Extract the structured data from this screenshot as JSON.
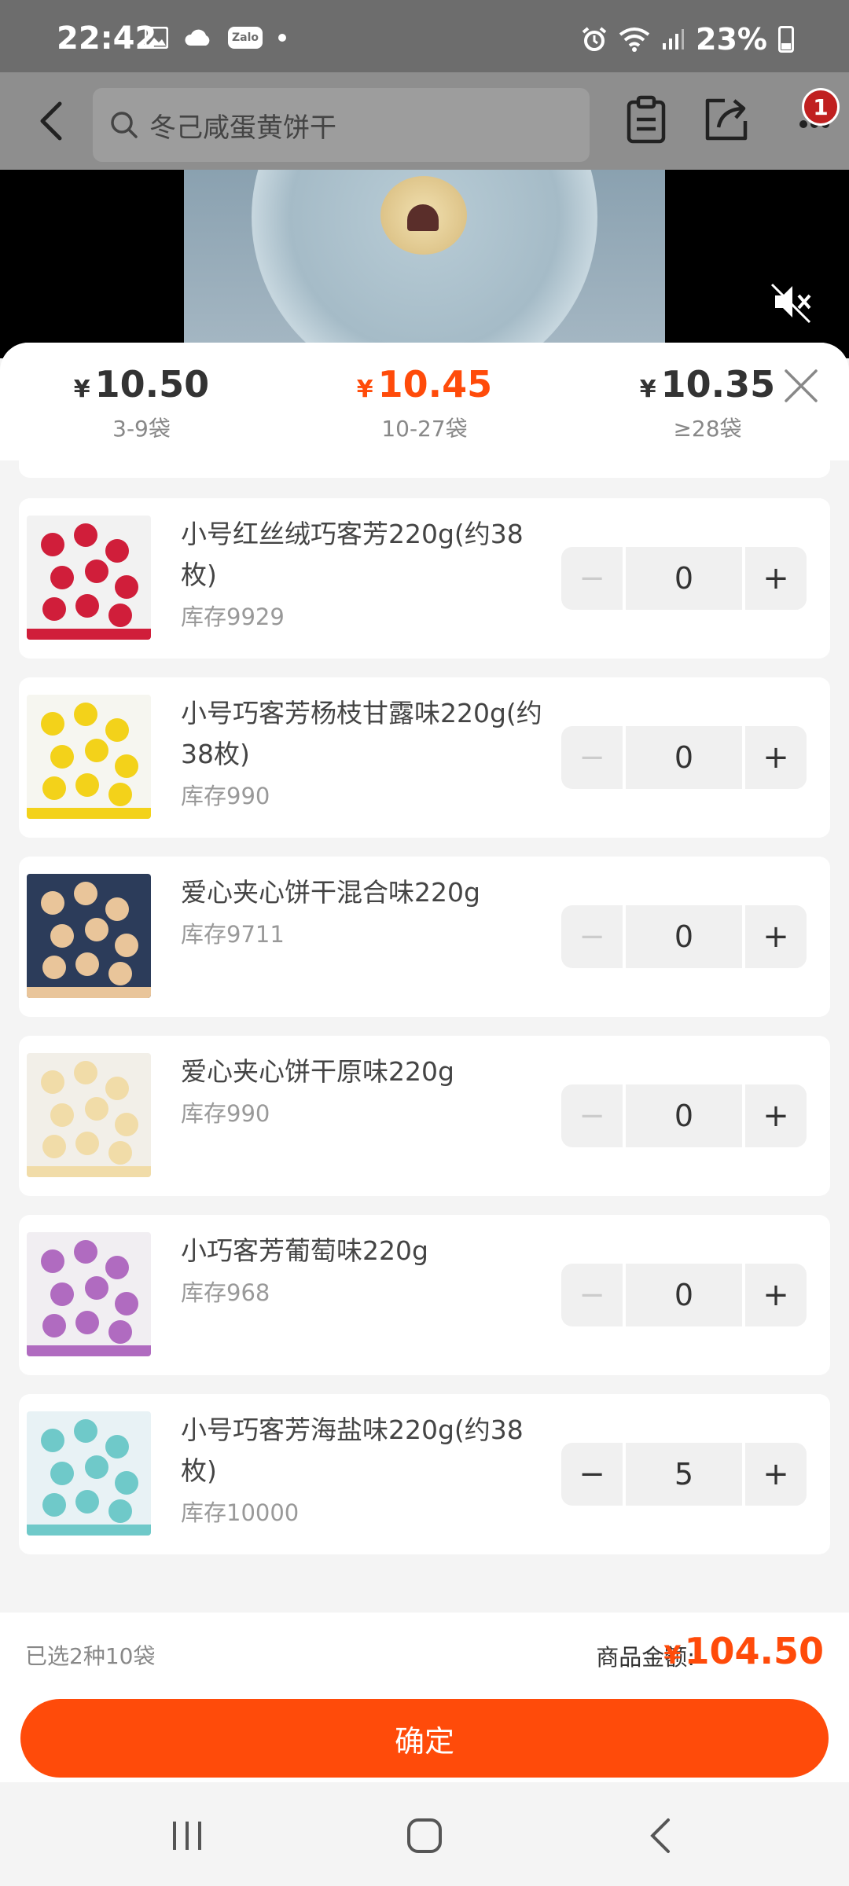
{
  "status": {
    "time": "22:42",
    "battery": "23%",
    "zalo": "Zalo"
  },
  "search": {
    "text": "冬己咸蛋黄饼干"
  },
  "cart": {
    "badge_count": "1"
  },
  "tiers": [
    {
      "currency": "¥",
      "price": "10.50",
      "range": "3-9袋",
      "active": false
    },
    {
      "currency": "¥",
      "price": "10.45",
      "range": "10-27袋",
      "active": true
    },
    {
      "currency": "¥",
      "price": "10.35",
      "range": "≥28袋",
      "active": false
    }
  ],
  "items": [
    {
      "name": "小号红丝绒巧客芳220g(约38枚)",
      "stock": "库存9929",
      "qty": "0",
      "colors": [
        "#d01e3a",
        "#f2f2f2"
      ]
    },
    {
      "name": "小号巧客芳杨枝甘露味220g(约38枚)",
      "stock": "库存990",
      "qty": "0",
      "colors": [
        "#f3d21a",
        "#f6f6f0"
      ]
    },
    {
      "name": "爱心夹心饼干混合味220g",
      "stock": "库存9711",
      "qty": "0",
      "colors": [
        "#e9c59a",
        "#2c3c5a"
      ]
    },
    {
      "name": "爱心夹心饼干原味220g",
      "stock": "库存990",
      "qty": "0",
      "colors": [
        "#f1dca8",
        "#f2efe8"
      ]
    },
    {
      "name": "小巧客芳葡萄味220g",
      "stock": "库存968",
      "qty": "0",
      "colors": [
        "#b06bc0",
        "#f1eef2"
      ]
    },
    {
      "name": "小号巧客芳海盐味220g(约38枚)",
      "stock": "库存10000",
      "qty": "5",
      "colors": [
        "#6fc9c9",
        "#e8f2f5"
      ]
    }
  ],
  "footer": {
    "summary": "已选2种10袋",
    "amount_label": "商品金额:",
    "currency": "¥",
    "amount": "104.50",
    "confirm": "确定"
  }
}
